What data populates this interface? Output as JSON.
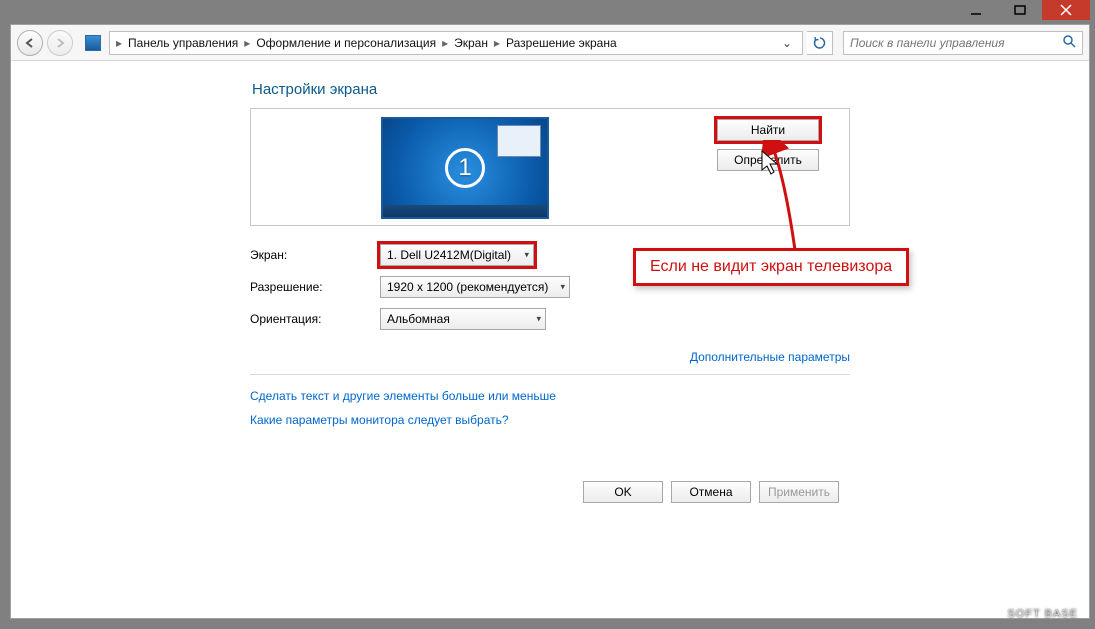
{
  "breadcrumb": {
    "items": [
      "Панель управления",
      "Оформление и персонализация",
      "Экран",
      "Разрешение экрана"
    ]
  },
  "search": {
    "placeholder": "Поиск в панели управления"
  },
  "heading": "Настройки экрана",
  "monitor_number": "1",
  "buttons": {
    "find": "Найти",
    "detect": "Определить",
    "ok": "OK",
    "cancel": "Отмена",
    "apply": "Применить"
  },
  "form": {
    "screen_label": "Экран:",
    "screen_value": "1. Dell U2412M(Digital)",
    "resolution_label": "Разрешение:",
    "resolution_value": "1920 x 1200 (рекомендуется)",
    "orientation_label": "Ориентация:",
    "orientation_value": "Альбомная"
  },
  "links": {
    "advanced": "Дополнительные параметры",
    "text_size": "Сделать текст и другие элементы больше или меньше",
    "monitor_help": "Какие параметры монитора следует выбрать?"
  },
  "callout": "Если не видит экран телевизора",
  "watermark": "SOFT BASE"
}
